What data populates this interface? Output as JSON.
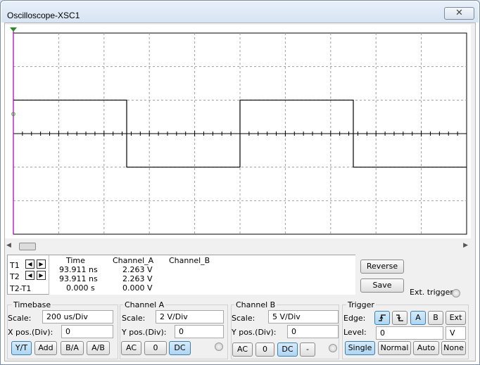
{
  "window": {
    "title": "Oscilloscope-XSC1",
    "close_glyph": "✕"
  },
  "readout": {
    "headers": [
      "Time",
      "Channel_A",
      "Channel_B"
    ],
    "rows": [
      {
        "label": "T1",
        "time": "93.911 ns",
        "channel_a": "2.263 V",
        "channel_b": ""
      },
      {
        "label": "T2",
        "time": "93.911 ns",
        "channel_a": "2.263 V",
        "channel_b": ""
      },
      {
        "label": "T2-T1",
        "time": "0.000 s",
        "channel_a": "0.000 V",
        "channel_b": ""
      }
    ]
  },
  "buttons": {
    "reverse": "Reverse",
    "save": "Save",
    "ext_trigger": "Ext. trigger"
  },
  "timebase": {
    "title": "Timebase",
    "scale_label": "Scale:",
    "scale_value": "200 us/Div",
    "xpos_label": "X pos.(Div):",
    "xpos_value": "0",
    "modes": [
      "Y/T",
      "Add",
      "B/A",
      "A/B"
    ],
    "active_mode": "Y/T"
  },
  "channel_a": {
    "title": "Channel A",
    "scale_label": "Scale:",
    "scale_value": "2  V/Div",
    "ypos_label": "Y pos.(Div):",
    "ypos_value": "0",
    "coupling": [
      "AC",
      "0",
      "DC"
    ],
    "active_coupling": "DC"
  },
  "channel_b": {
    "title": "Channel B",
    "scale_label": "Scale:",
    "scale_value": "5  V/Div",
    "ypos_label": "Y pos.(Div):",
    "ypos_value": "0",
    "coupling": [
      "AC",
      "0",
      "DC",
      "-"
    ],
    "active_coupling": "DC"
  },
  "trigger": {
    "title": "Trigger",
    "edge_label": "Edge:",
    "edge_rising_icon": "rising-edge-icon",
    "edge_falling_icon": "falling-edge-icon",
    "sources": [
      "A",
      "B",
      "Ext"
    ],
    "active_source": "A",
    "level_label": "Level:",
    "level_value": "0",
    "level_unit": "V",
    "modes": [
      "Single",
      "Normal",
      "Auto",
      "None"
    ],
    "active_mode": "Single"
  },
  "colors": {
    "trace": "#000000",
    "cursor_t1": "#c000c0",
    "active_button": "#aed5f3"
  },
  "chart_data": {
    "type": "line",
    "grid": true,
    "divisions": {
      "x": 10,
      "y": 6
    },
    "series": [
      {
        "name": "Channel_A",
        "x_div": [
          0,
          0,
          2.5,
          2.5,
          5,
          5,
          7.5,
          7.5,
          10
        ],
        "y_div": [
          1,
          1,
          1,
          -1,
          -1,
          1,
          1,
          -1,
          -1
        ]
      }
    ],
    "cursors": {
      "t1_div": 0,
      "t2_div": 0
    }
  }
}
